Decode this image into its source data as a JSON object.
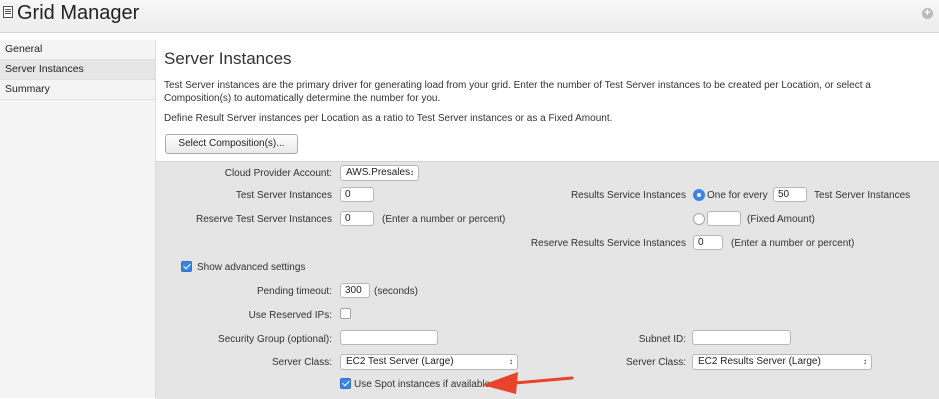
{
  "header": {
    "title": "Grid Manager"
  },
  "sidebar": {
    "items": [
      {
        "label": "General"
      },
      {
        "label": "Server Instances",
        "active": true
      },
      {
        "label": "Summary"
      }
    ]
  },
  "main": {
    "title": "Server Instances",
    "intro": "Test Server instances are the primary driver for generating load from your grid. Enter the number of Test Server instances to be created per Location, or select a Composition(s) to automatically determine the number for you.",
    "define_text": "Define Result Server instances per Location as a ratio to Test Server instances or as a Fixed Amount.",
    "select_composition_label": "Select Composition(s)..."
  },
  "form": {
    "cloud_provider_label": "Cloud Provider Account:",
    "cloud_provider_value": "AWS.Presales",
    "test_server_label": "Test Server Instances",
    "test_server_value": "0",
    "reserve_test_label": "Reserve Test Server Instances",
    "reserve_test_value": "0",
    "reserve_test_hint": "(Enter a number or percent)",
    "results_service_label": "Results Service Instances",
    "one_for_every_label": "One for every",
    "one_for_every_value": "50",
    "one_for_every_suffix": "Test Server Instances",
    "fixed_amount_value": "",
    "fixed_amount_label": "(Fixed Amount)",
    "reserve_results_label": "Reserve Results Service Instances",
    "reserve_results_value": "0",
    "reserve_results_hint": "(Enter a number or percent)",
    "show_advanced_label": "Show advanced settings",
    "pending_timeout_label": "Pending timeout:",
    "pending_timeout_value": "300",
    "pending_timeout_unit": "(seconds)",
    "reserved_ips_label": "Use Reserved IPs:",
    "security_group_label": "Security Group (optional):",
    "security_group_value": "",
    "subnet_label": "Subnet ID:",
    "subnet_value": "",
    "server_class_label": "Server Class:",
    "server_class_value": "EC2 Test Server (Large)",
    "results_server_class_label": "Server Class:",
    "results_server_class_value": "EC2 Results Server (Large)",
    "spot_label": "Use Spot instances if available"
  },
  "colors": {
    "accent": "#3b84e6",
    "panel": "#e5e5e5",
    "arrow": "#e8432b"
  }
}
